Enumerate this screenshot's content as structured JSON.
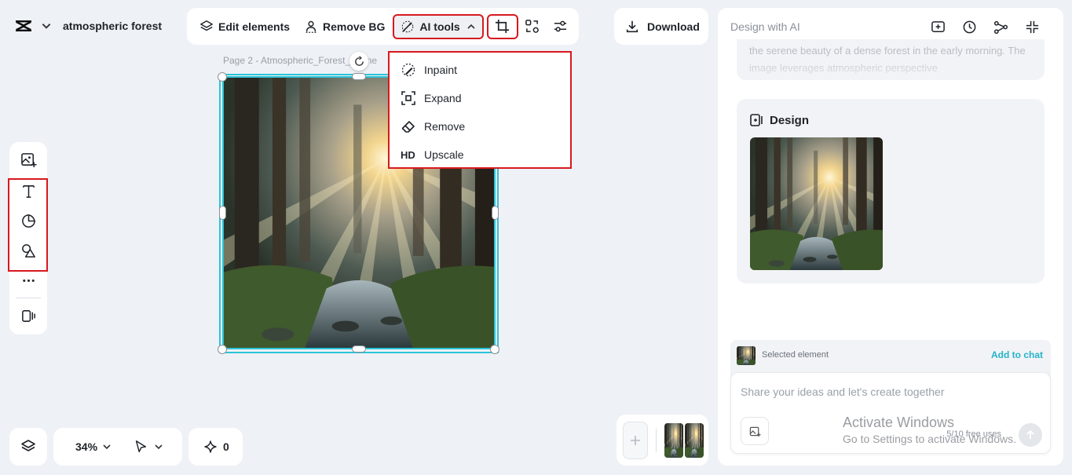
{
  "header": {
    "project_title": "atmospheric forest",
    "logo_icon": "capcut-logo-icon"
  },
  "toolbar": {
    "edit_elements_label": "Edit elements",
    "remove_bg_label": "Remove BG",
    "ai_tools_label": "AI tools",
    "download_label": "Download"
  },
  "ai_tools_menu": {
    "items": [
      {
        "label": "Inpaint",
        "icon": "inpaint-brush-icon"
      },
      {
        "label": "Expand",
        "icon": "expand-icon"
      },
      {
        "label": "Remove",
        "icon": "eraser-icon"
      },
      {
        "label": "Upscale",
        "icon": "hd-icon",
        "icon_text": "HD"
      }
    ]
  },
  "canvas": {
    "page_label": "Page 2 -   Atmospheric_Forest_Scene"
  },
  "bottom": {
    "zoom": "34%",
    "ai_credits": "0"
  },
  "panel": {
    "title": "Design with AI",
    "message_text": "the serene beauty of a dense forest in the early morning. The image leverages atmospheric perspective",
    "design_heading": "Design",
    "selected_element_label": "Selected element",
    "add_to_chat_label": "Add to chat",
    "chat_placeholder": "Share your ideas and let's create together",
    "free_uses": "5/10 free uses"
  },
  "watermark": {
    "line1": "Activate Windows",
    "line2": "Go to Settings to activate Windows."
  },
  "colors": {
    "accent": "#2bc4d8",
    "highlight_red": "#d7191e",
    "background": "#eef1f5",
    "link": "#25b3c9"
  }
}
